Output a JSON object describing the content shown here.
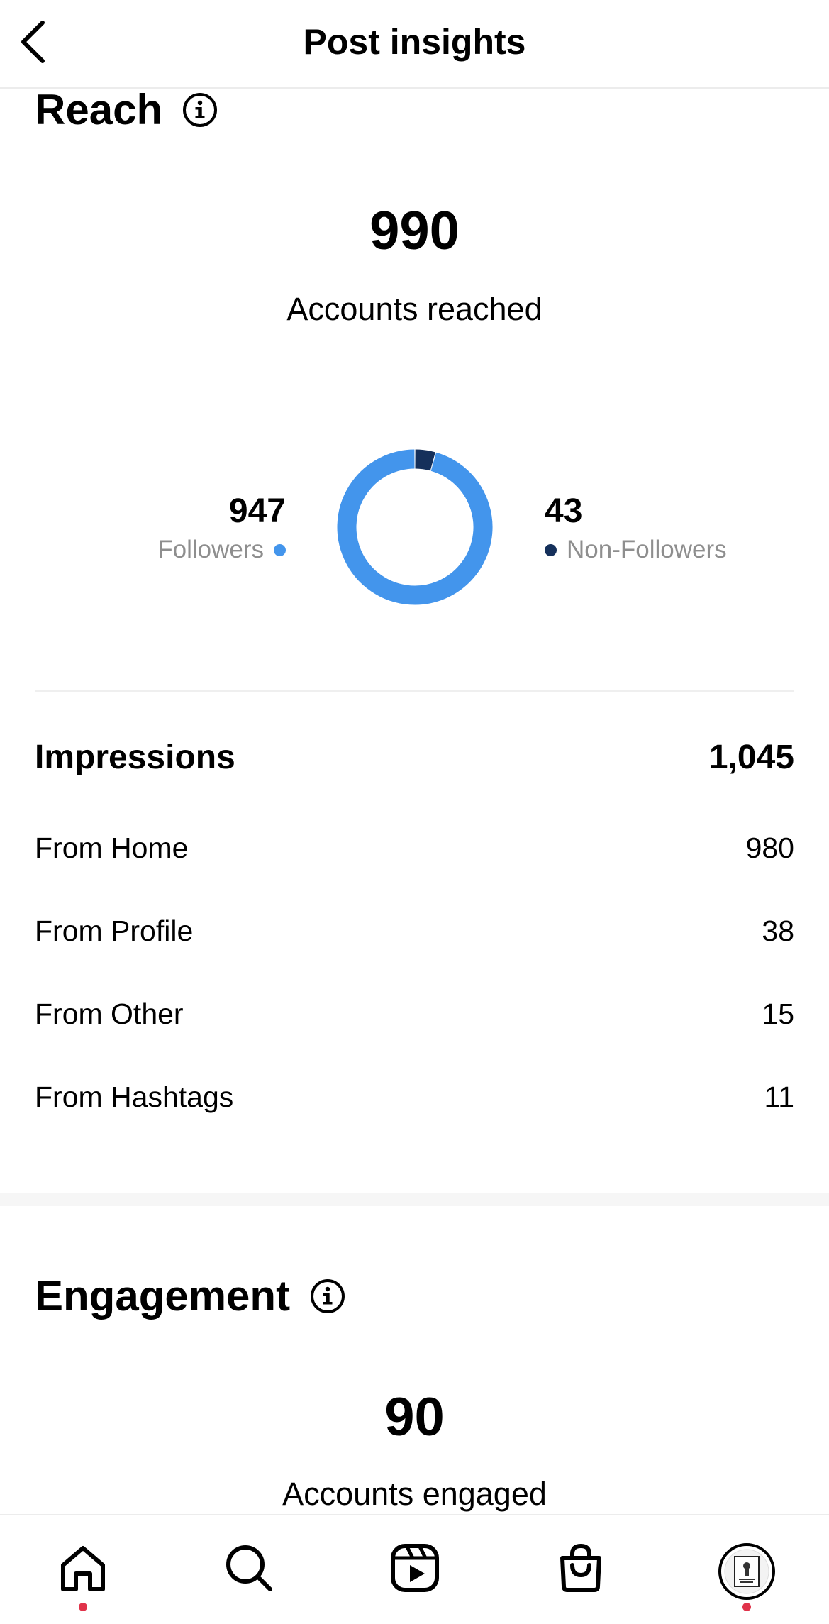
{
  "header": {
    "title": "Post insights",
    "back_icon": "chevron-left-icon"
  },
  "reach": {
    "title": "Reach",
    "info_icon": "info-icon",
    "total": "990",
    "total_label": "Accounts reached",
    "followers": {
      "value": "947",
      "label": "Followers",
      "color": "#4395ec"
    },
    "non_followers": {
      "value": "43",
      "label": "Non-Followers",
      "color": "#15305b"
    }
  },
  "chart_data": {
    "type": "pie",
    "categories": [
      "Followers",
      "Non-Followers"
    ],
    "values": [
      947,
      43
    ],
    "colors": [
      "#4395ec",
      "#15305b"
    ],
    "style": "donut"
  },
  "impressions": {
    "label": "Impressions",
    "value": "1,045",
    "rows": [
      {
        "label": "From Home",
        "value": "980"
      },
      {
        "label": "From Profile",
        "value": "38"
      },
      {
        "label": "From Other",
        "value": "15"
      },
      {
        "label": "From Hashtags",
        "value": "11"
      }
    ]
  },
  "engagement": {
    "title": "Engagement",
    "info_icon": "info-icon",
    "total": "90",
    "total_label": "Accounts engaged"
  },
  "nav": {
    "items": [
      {
        "name": "home",
        "icon": "home-icon",
        "has_dot": true
      },
      {
        "name": "search",
        "icon": "search-icon",
        "has_dot": false
      },
      {
        "name": "reels",
        "icon": "reels-icon",
        "has_dot": false
      },
      {
        "name": "shop",
        "icon": "shop-bag-icon",
        "has_dot": false
      },
      {
        "name": "profile",
        "icon": "profile-avatar",
        "has_dot": true
      }
    ],
    "dot_color": "#e0334a"
  }
}
